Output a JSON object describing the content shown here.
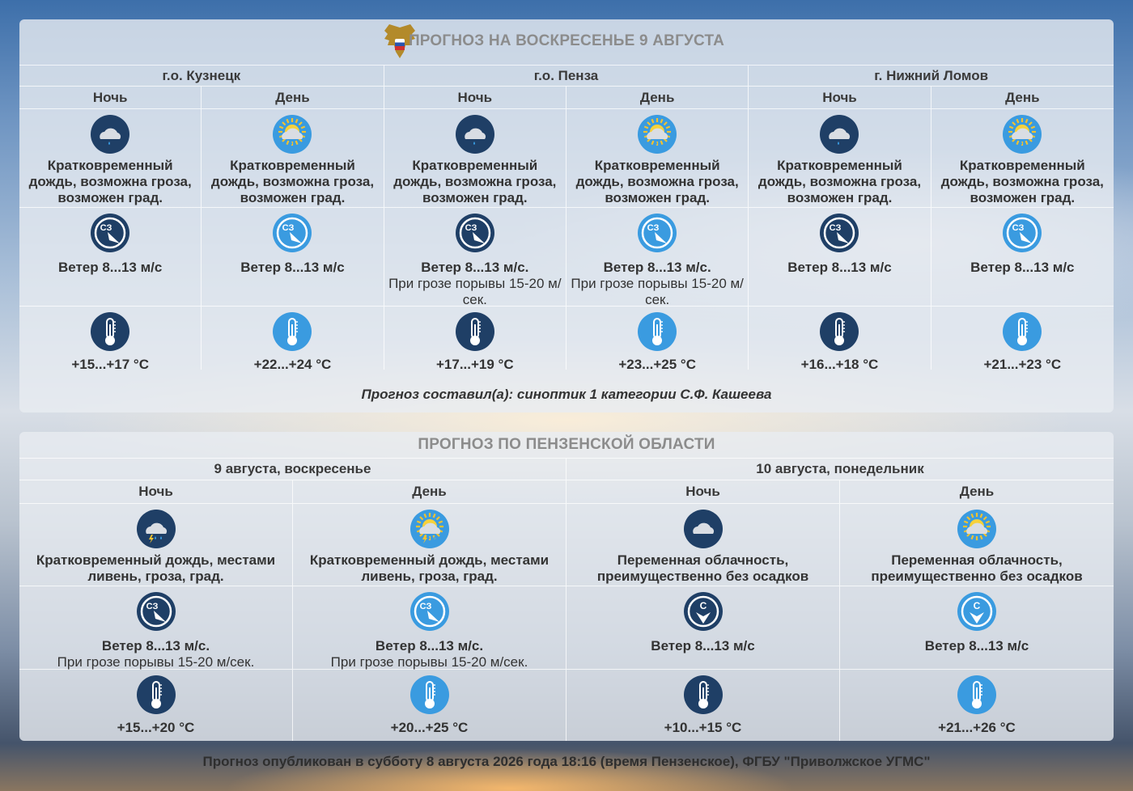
{
  "panel1": {
    "title": "ПРОГНОЗ НА ВОСКРЕСЕНЬЕ 9 АВГУСТА",
    "locations": [
      "г.о. Кузнецк",
      "г.о. Пенза",
      "г. Нижний Ломов"
    ],
    "periods": [
      "Ночь",
      "День",
      "Ночь",
      "День",
      "Ночь",
      "День"
    ],
    "columns": [
      {
        "weather_icon": "night-cloud-rain-icon",
        "weather": "Кратковременный дождь, возможна гроза, возможен град.",
        "wind_dir": "СЗ",
        "wind": "Ветер 8...13 м/с",
        "gust": "",
        "temp": "+15...+17 °C",
        "night": true
      },
      {
        "weather_icon": "sun-cloud-rain-icon",
        "weather": "Кратковременный дождь, возможна гроза, возможен град.",
        "wind_dir": "СЗ",
        "wind": "Ветер 8...13 м/с",
        "gust": "",
        "temp": "+22...+24 °C",
        "night": false
      },
      {
        "weather_icon": "night-cloud-rain-icon",
        "weather": "Кратковременный дождь, возможна гроза, возможен град.",
        "wind_dir": "СЗ",
        "wind": "Ветер 8...13 м/с.",
        "gust": "При грозе порывы 15-20 м/сек.",
        "temp": "+17...+19 °C",
        "night": true
      },
      {
        "weather_icon": "sun-cloud-rain-icon",
        "weather": "Кратковременный дождь, возможна гроза, возможен град.",
        "wind_dir": "СЗ",
        "wind": "Ветер 8...13 м/с.",
        "gust": "При грозе порывы 15-20 м/сек.",
        "temp": "+23...+25 °C",
        "night": false
      },
      {
        "weather_icon": "night-cloud-rain-icon",
        "weather": "Кратковременный дождь, возможна гроза, возможен град.",
        "wind_dir": "СЗ",
        "wind": "Ветер 8...13 м/с",
        "gust": "",
        "temp": "+16...+18 °C",
        "night": true
      },
      {
        "weather_icon": "sun-cloud-rain-icon",
        "weather": "Кратковременный дождь, возможна гроза, возможен град.",
        "wind_dir": "СЗ",
        "wind": "Ветер 8...13 м/с",
        "gust": "",
        "temp": "+21...+23 °C",
        "night": false
      }
    ],
    "author": "Прогноз составил(а): синоптик 1 категории С.Ф. Кашеева"
  },
  "panel2": {
    "title": "ПРОГНОЗ ПО ПЕНЗЕНСКОЙ ОБЛАСТИ",
    "days": [
      "9 августа, воскресенье",
      "10 августа, понедельник"
    ],
    "periods": [
      "Ночь",
      "День",
      "Ночь",
      "День"
    ],
    "columns": [
      {
        "weather_icon": "night-cloud-thunder-rain-icon",
        "weather": "Кратковременный дождь, местами ливень, гроза, град.",
        "wind_dir": "СЗ",
        "wind": "Ветер 8...13 м/с.",
        "gust": "При грозе порывы 15-20 м/сек.",
        "temp": "+15...+20 °C",
        "night": true
      },
      {
        "weather_icon": "sun-cloud-thunder-rain-icon",
        "weather": "Кратковременный дождь, местами ливень, гроза, град.",
        "wind_dir": "СЗ",
        "wind": "Ветер 8...13 м/с.",
        "gust": "При грозе порывы 15-20 м/сек.",
        "temp": "+20...+25 °C",
        "night": false
      },
      {
        "weather_icon": "night-cloud-icon",
        "weather": "Переменная облачность, преимущественно без осадков",
        "wind_dir": "С",
        "wind": "Ветер 8...13 м/с",
        "gust": "",
        "temp": "+10...+15 °C",
        "night": true
      },
      {
        "weather_icon": "sun-cloud-icon",
        "weather": "Переменная облачность, преимущественно без осадков",
        "wind_dir": "С",
        "wind": "Ветер 8...13 м/с",
        "gust": "",
        "temp": "+21...+26 °C",
        "night": false
      }
    ]
  },
  "footer": "Прогноз опубликован в субботу 8 августа 2026 года 18:16 (время Пензенское), ФГБУ \"Приволжское УГМС\"",
  "colors": {
    "night": "#1f3f66",
    "day": "#3a9be0"
  }
}
